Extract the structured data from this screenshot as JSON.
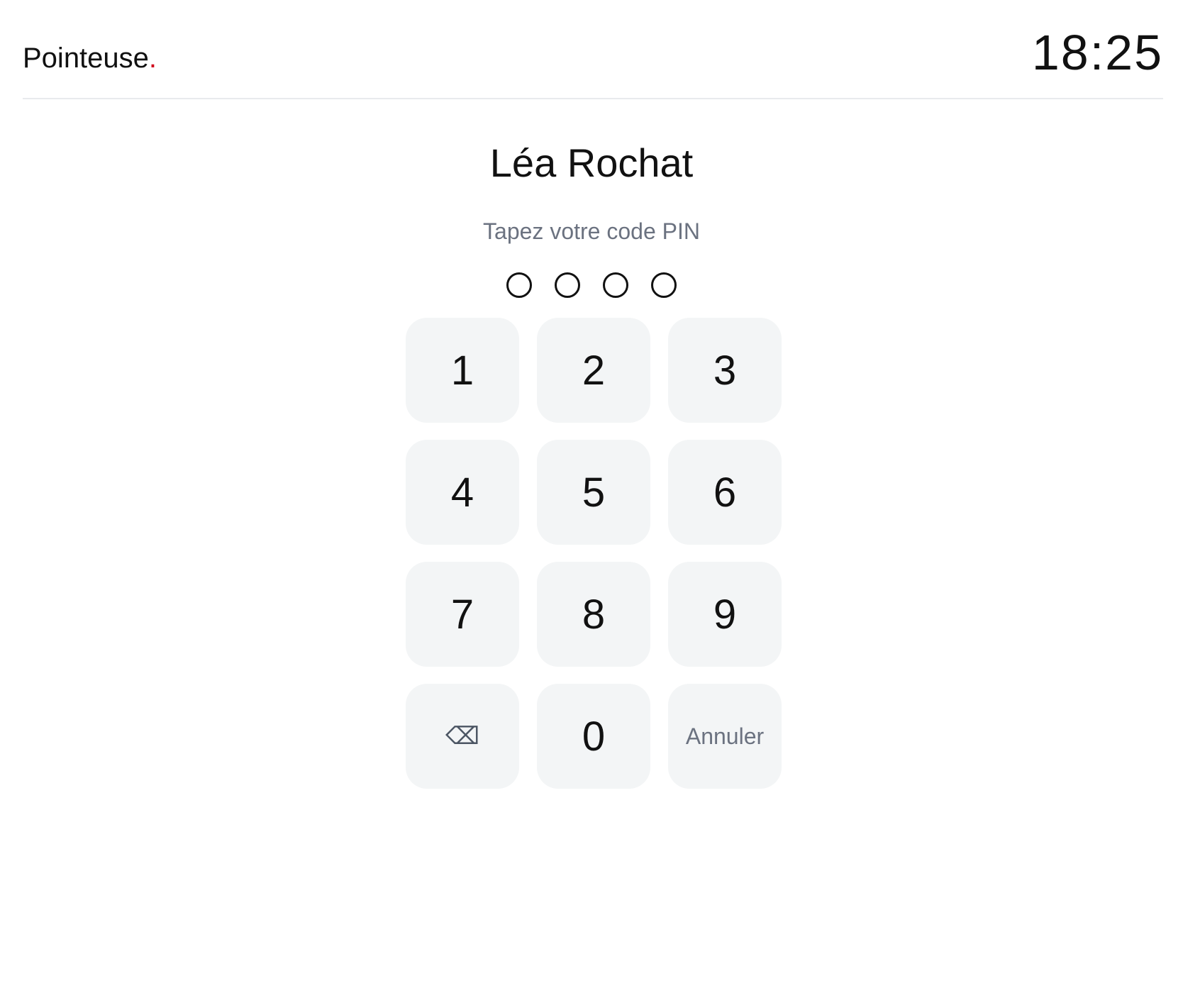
{
  "header": {
    "brand": "Pointeuse",
    "brand_dot": ".",
    "time": "18:25"
  },
  "user": {
    "name": "Léa Rochat"
  },
  "pin": {
    "prompt": "Tapez votre code PIN",
    "length": 4
  },
  "keypad": {
    "k1": "1",
    "k2": "2",
    "k3": "3",
    "k4": "4",
    "k5": "5",
    "k6": "6",
    "k7": "7",
    "k8": "8",
    "k9": "9",
    "k0": "0",
    "backspace_icon": "backspace-icon",
    "backspace_glyph": "⌫",
    "cancel": "Annuler"
  },
  "colors": {
    "accent": "#d0021b",
    "key_bg": "#f3f5f6",
    "muted_text": "#6b7280"
  }
}
